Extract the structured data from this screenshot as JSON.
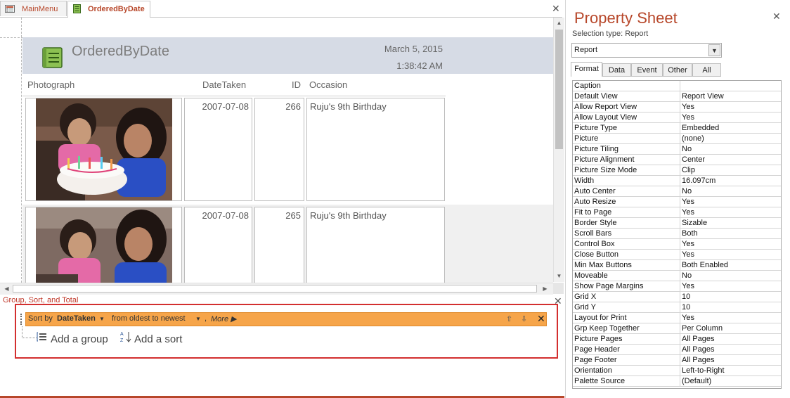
{
  "tabs": [
    {
      "label": "MainMenu",
      "active": false
    },
    {
      "label": "OrderedByDate",
      "active": true
    }
  ],
  "report": {
    "title": "OrderedByDate",
    "date": "March 5, 2015",
    "time": "1:38:42 AM",
    "columns": {
      "photo": "Photograph",
      "date": "DateTaken",
      "id": "ID",
      "occasion": "Occasion"
    },
    "rows": [
      {
        "date": "2007-07-08",
        "id": "266",
        "occasion": "Ruju's 9th Birthday"
      },
      {
        "date": "2007-07-08",
        "id": "265",
        "occasion": "Ruju's 9th Birthday"
      }
    ]
  },
  "gst": {
    "title": "Group, Sort, and Total",
    "sort_by_label": "Sort by",
    "sort_field": "DateTaken",
    "sort_order": "from oldest to newest",
    "sort_sep": ",",
    "more": "More ▶",
    "add_group": "Add a group",
    "add_sort": "Add a sort"
  },
  "property_sheet": {
    "title": "Property Sheet",
    "selection_type": "Selection type:  Report",
    "selected_object": "Report",
    "tabs": [
      "Format",
      "Data",
      "Event",
      "Other",
      "All"
    ],
    "rows": [
      [
        "Caption",
        ""
      ],
      [
        "Default View",
        "Report View"
      ],
      [
        "Allow Report View",
        "Yes"
      ],
      [
        "Allow Layout View",
        "Yes"
      ],
      [
        "Picture Type",
        "Embedded"
      ],
      [
        "Picture",
        "(none)"
      ],
      [
        "Picture Tiling",
        "No"
      ],
      [
        "Picture Alignment",
        "Center"
      ],
      [
        "Picture Size Mode",
        "Clip"
      ],
      [
        "Width",
        "16.097cm"
      ],
      [
        "Auto Center",
        "No"
      ],
      [
        "Auto Resize",
        "Yes"
      ],
      [
        "Fit to Page",
        "Yes"
      ],
      [
        "Border Style",
        "Sizable"
      ],
      [
        "Scroll Bars",
        "Both"
      ],
      [
        "Control Box",
        "Yes"
      ],
      [
        "Close Button",
        "Yes"
      ],
      [
        "Min Max Buttons",
        "Both Enabled"
      ],
      [
        "Moveable",
        "No"
      ],
      [
        "Show Page Margins",
        "Yes"
      ],
      [
        "Grid X",
        "10"
      ],
      [
        "Grid Y",
        "10"
      ],
      [
        "Layout for Print",
        "Yes"
      ],
      [
        "Grp Keep Together",
        "Per Column"
      ],
      [
        "Picture Pages",
        "All Pages"
      ],
      [
        "Page Header",
        "All Pages"
      ],
      [
        "Page Footer",
        "All Pages"
      ],
      [
        "Orientation",
        "Left-to-Right"
      ],
      [
        "Palette Source",
        "(Default)"
      ]
    ]
  },
  "colors": {
    "accent": "#b7472a",
    "sort_bar": "#f6a54a",
    "highlight_box": "#d32f2f"
  }
}
